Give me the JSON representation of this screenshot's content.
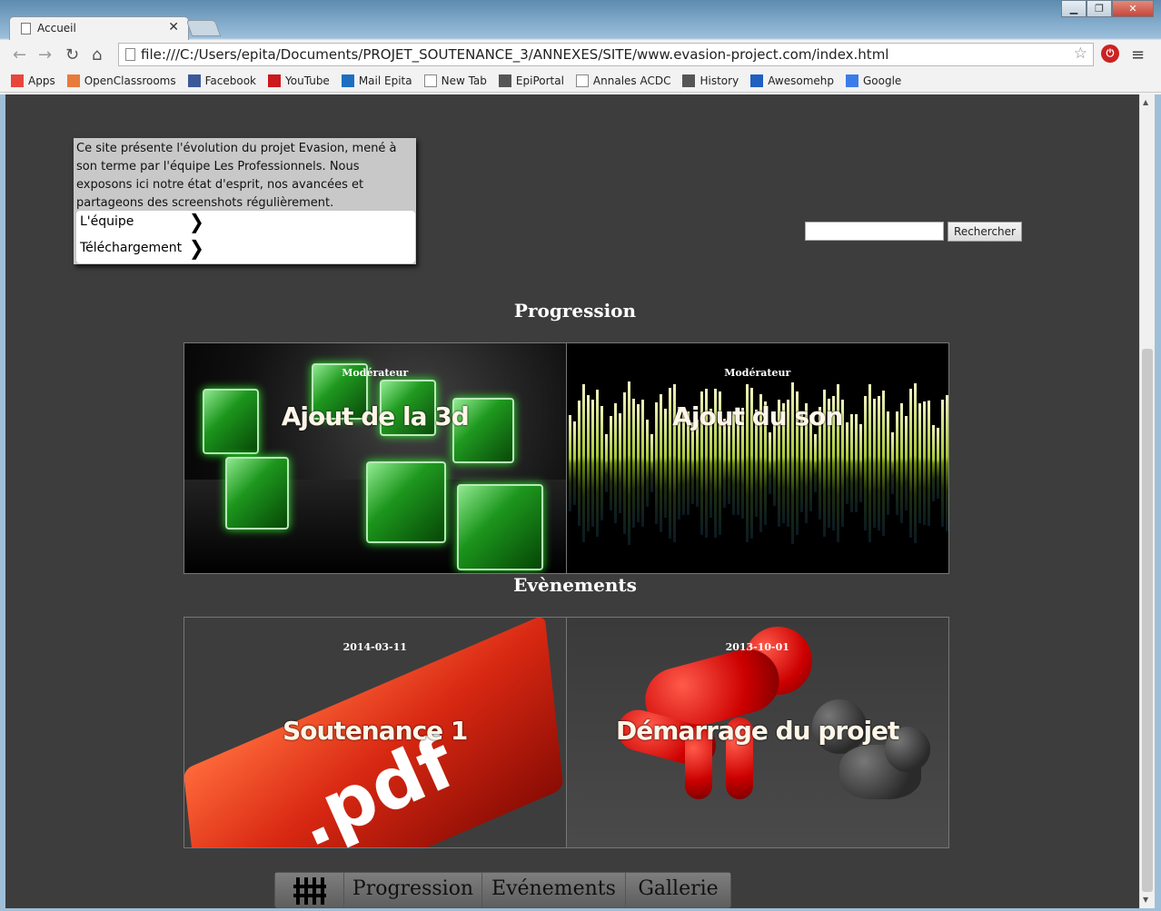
{
  "browser": {
    "tab_title": "Accueil",
    "url": "file:///C:/Users/epita/Documents/PROJET_SOUTENANCE_3/ANNEXES/SITE/www.evasion-project.com/index.html",
    "bookmarks": [
      {
        "label": "Apps",
        "icon": "apps-grid-icon",
        "color": "#e8453c"
      },
      {
        "label": "OpenClassrooms",
        "icon": "openclassrooms-icon",
        "color": "#e87a3c"
      },
      {
        "label": "Facebook",
        "icon": "facebook-icon",
        "color": "#3b5998"
      },
      {
        "label": "YouTube",
        "icon": "youtube-icon",
        "color": "#cc181e"
      },
      {
        "label": "Mail Epita",
        "icon": "outlook-icon",
        "color": "#1e6fc0"
      },
      {
        "label": "New Tab",
        "icon": "page-icon",
        "color": "#ffffff"
      },
      {
        "label": "EpiPortal",
        "icon": "folder-icon",
        "color": "#555555"
      },
      {
        "label": "Annales ACDC",
        "icon": "page-icon",
        "color": "#ffffff"
      },
      {
        "label": "History",
        "icon": "clock-icon",
        "color": "#555555"
      },
      {
        "label": "Awesomehp",
        "icon": "awesomehp-icon",
        "color": "#1e5fbf"
      },
      {
        "label": "Google",
        "icon": "google-icon",
        "color": "#3b7de8"
      }
    ]
  },
  "intro": {
    "text": "Ce site présente l'évolution du projet Evasion, mené à son terme par l'équipe Les Professionnels. Nous exposons ici notre état d'esprit, nos avancées et partageons des screenshots régulièrement.",
    "links": [
      "L'équipe",
      "Téléchargement"
    ]
  },
  "search": {
    "button_label": "Rechercher",
    "value": ""
  },
  "progression": {
    "title": "Progression",
    "cards": [
      {
        "subtitle": "Modérateur",
        "title": "Ajout de la 3d"
      },
      {
        "subtitle": "Modérateur",
        "title": "Ajout du son"
      }
    ]
  },
  "events": {
    "title": "Evènements",
    "cards": [
      {
        "subtitle": "2014-03-11",
        "title": "Soutenance 1",
        "image_text": ".pdf"
      },
      {
        "subtitle": "2013-10-01",
        "title": "Démarrage du projet"
      }
    ]
  },
  "footer_nav": {
    "items": [
      "Progression",
      "Evénements",
      "Gallerie"
    ]
  }
}
